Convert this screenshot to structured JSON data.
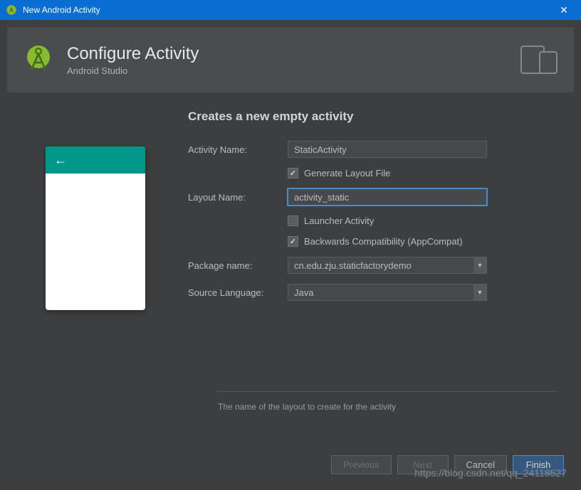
{
  "titlebar": {
    "title": "New Android Activity"
  },
  "header": {
    "title": "Configure Activity",
    "subtitle": "Android Studio"
  },
  "section": {
    "title": "Creates a new empty activity"
  },
  "form": {
    "activity_name_label": "Activity Name:",
    "activity_name_value": "StaticActivity",
    "generate_layout_label": "Generate Layout File",
    "generate_layout_checked": true,
    "layout_name_label": "Layout Name:",
    "layout_name_value": "activity_static",
    "launcher_label": "Launcher Activity",
    "launcher_checked": false,
    "backwards_label": "Backwards Compatibility (AppCompat)",
    "backwards_checked": true,
    "package_label": "Package name:",
    "package_value": "cn.edu.zju.staticfactorydemo",
    "source_lang_label": "Source Language:",
    "source_lang_value": "Java"
  },
  "hint": "The name of the layout to create for the activity",
  "buttons": {
    "previous": "Previous",
    "next": "Next",
    "cancel": "Cancel",
    "finish": "Finish"
  },
  "watermark": "https://blog.csdn.net/qq_24118527"
}
